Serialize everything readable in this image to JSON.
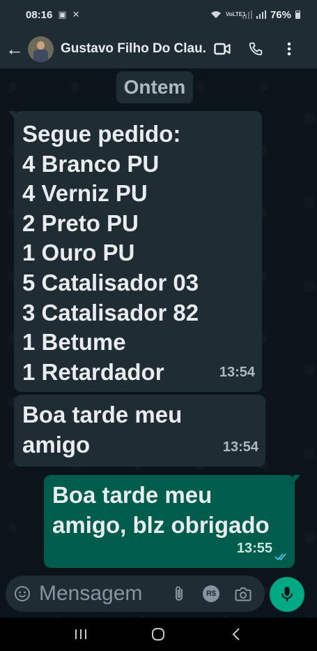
{
  "status_bar": {
    "time": "08:16",
    "network": "VoLTE1",
    "battery": "76%"
  },
  "header": {
    "contact_name": "Gustavo Filho Do Clau..."
  },
  "chat": {
    "date_separator": "Ontem",
    "messages": [
      {
        "direction": "incoming",
        "lines": [
          "Segue pedido:",
          "4 Branco PU",
          "4 Verniz PU",
          "2 Preto PU",
          "1 Ouro PU",
          "5 Catalisador 03",
          "3 Catalisador 82",
          "1 Betume",
          "1 Retardador"
        ],
        "time": "13:54"
      },
      {
        "direction": "incoming",
        "lines": [
          "Boa tarde meu",
          "amigo"
        ],
        "time": "13:54"
      },
      {
        "direction": "outgoing",
        "lines": [
          "Boa tarde meu",
          "amigo, blz obrigado"
        ],
        "time": "13:55",
        "status": "read"
      }
    ]
  },
  "composer": {
    "placeholder": "Mensagem",
    "icons": [
      "emoji-icon",
      "attach-icon",
      "payment-icon",
      "camera-icon",
      "mic-icon"
    ],
    "payment_label": "R$"
  },
  "colors": {
    "incoming_bubble": "#1f2c33",
    "outgoing_bubble": "#005c4b",
    "accent": "#00a884",
    "read_ticks": "#53bdeb"
  }
}
